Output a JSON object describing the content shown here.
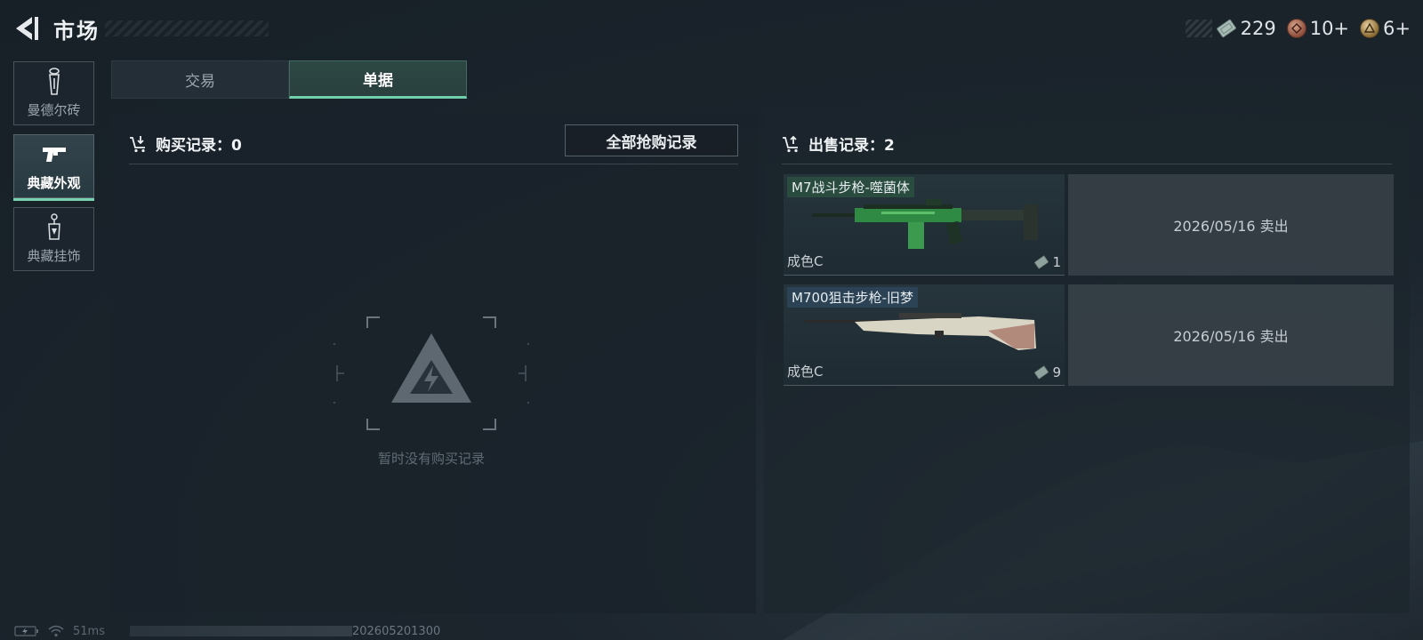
{
  "header": {
    "title": "市场",
    "back_icon": "back-arrow-icon"
  },
  "currencies": [
    {
      "icon": "ticket-icon",
      "value": "229"
    },
    {
      "icon": "copper-coin-icon",
      "value": "10+"
    },
    {
      "icon": "gold-coin-icon",
      "value": "6+"
    }
  ],
  "sidebar": {
    "items": [
      {
        "label": "曼德尔砖",
        "icon": "brick-icon",
        "active": false
      },
      {
        "label": "典藏外观",
        "icon": "pistol-icon",
        "active": true
      },
      {
        "label": "典藏挂饰",
        "icon": "charm-icon",
        "active": false
      }
    ]
  },
  "tabs": [
    {
      "label": "交易",
      "active": false
    },
    {
      "label": "单据",
      "active": true
    }
  ],
  "buy_panel": {
    "header": "购买记录：0",
    "all_button": "全部抢购记录",
    "empty_text": "暂时没有购买记录"
  },
  "sell_panel": {
    "header": "出售记录：2",
    "items": [
      {
        "name": "M7战斗步枪-噬菌体",
        "condition": "成色C",
        "price": "1",
        "sale_text": "2026/05/16 卖出",
        "name_color": "#2c5642"
      },
      {
        "name": "M700狙击步枪-旧梦",
        "condition": "成色C",
        "price": "9",
        "sale_text": "2026/05/16 卖出",
        "name_color": "#2e465c"
      }
    ]
  },
  "statusbar": {
    "ping": "51ms",
    "build": "202605201300"
  },
  "colors": {
    "accent": "#6fd1ab",
    "background": "#1c252d"
  }
}
